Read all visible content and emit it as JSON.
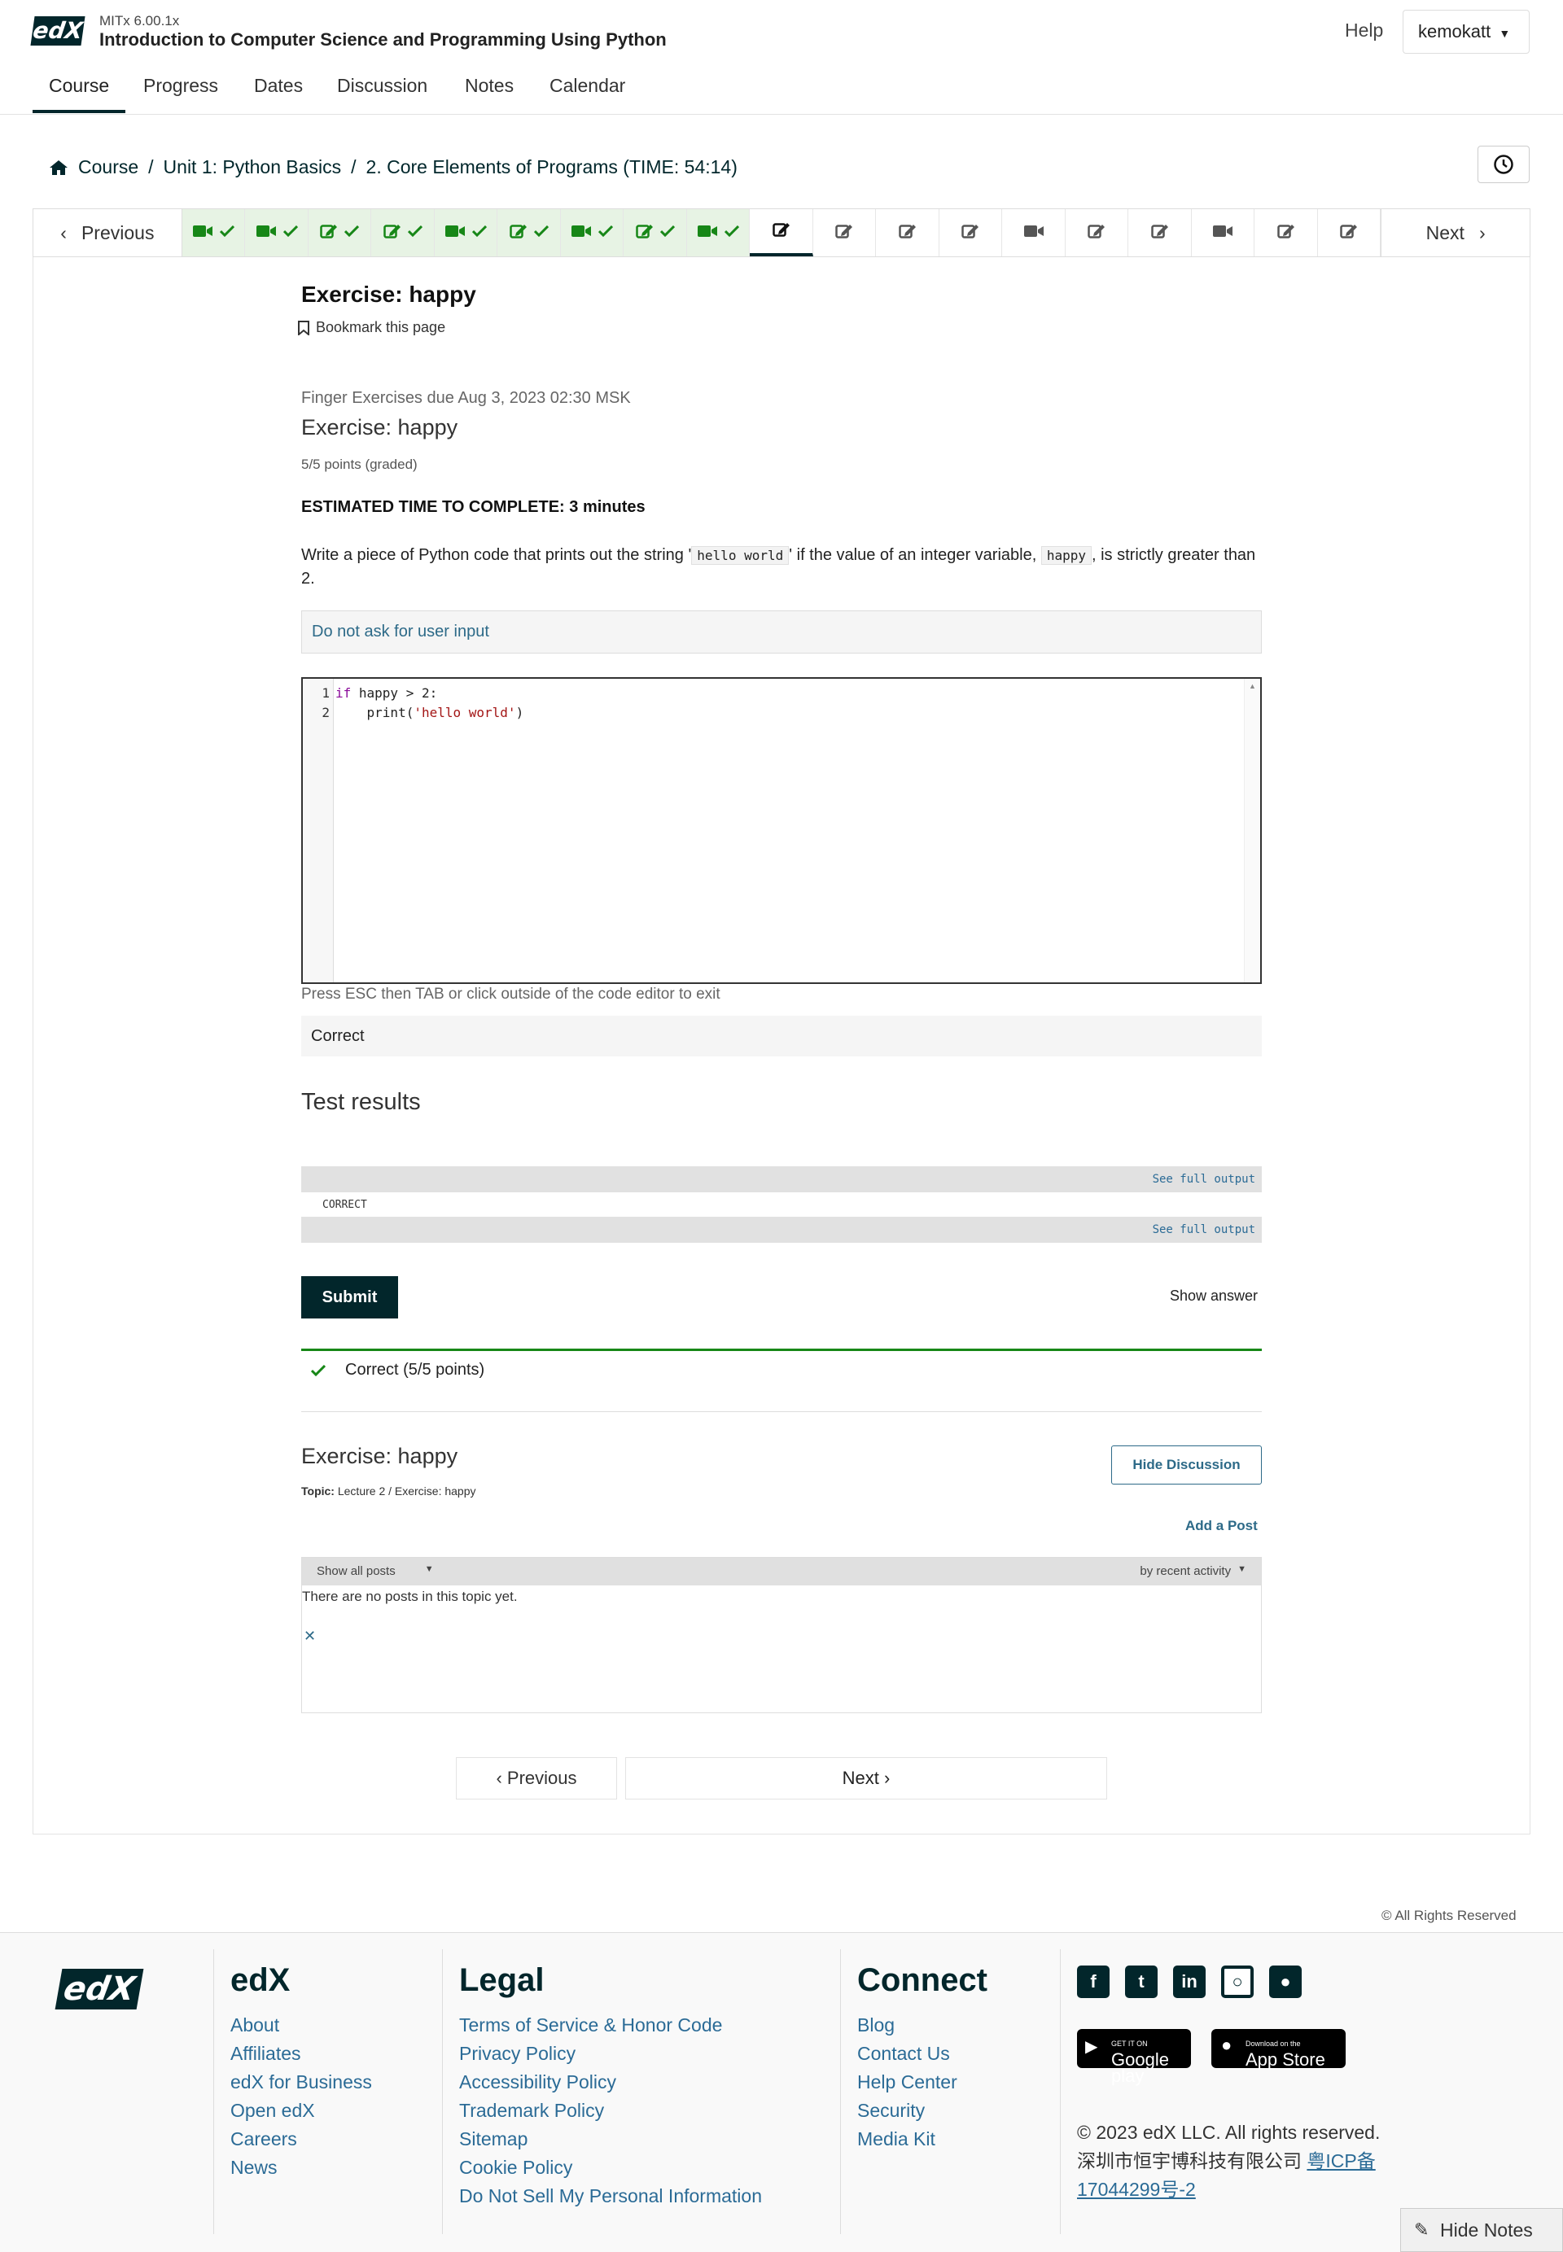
{
  "header": {
    "course_code": "MITx 6.00.1x",
    "course_title": "Introduction to Computer Science and Programming Using Python",
    "help": "Help",
    "username": "kemokatt",
    "tabs": [
      {
        "label": "Course"
      },
      {
        "label": "Progress"
      },
      {
        "label": "Dates"
      },
      {
        "label": "Discussion"
      },
      {
        "label": "Notes"
      },
      {
        "label": "Calendar"
      }
    ]
  },
  "breadcrumb": {
    "course": "Course",
    "unit": "Unit 1: Python Basics",
    "section": "2. Core Elements of Programs (TIME: 54:14)"
  },
  "sequence": {
    "previous": "Previous",
    "next": "Next",
    "tabs": [
      {
        "icon": "video-icon",
        "done": true
      },
      {
        "icon": "video-icon",
        "done": true
      },
      {
        "icon": "edit-icon",
        "done": true
      },
      {
        "icon": "edit-icon",
        "done": true
      },
      {
        "icon": "video-icon",
        "done": true
      },
      {
        "icon": "edit-icon",
        "done": true
      },
      {
        "icon": "video-icon",
        "done": true
      },
      {
        "icon": "edit-icon",
        "done": true
      },
      {
        "icon": "video-icon",
        "done": true
      },
      {
        "icon": "edit-icon",
        "done": false,
        "current": true
      },
      {
        "icon": "edit-icon",
        "done": false
      },
      {
        "icon": "edit-icon",
        "done": false
      },
      {
        "icon": "edit-icon",
        "done": false
      },
      {
        "icon": "video-icon",
        "done": false
      },
      {
        "icon": "edit-icon",
        "done": false
      },
      {
        "icon": "edit-icon",
        "done": false
      },
      {
        "icon": "video-icon",
        "done": false
      },
      {
        "icon": "edit-icon",
        "done": false
      },
      {
        "icon": "edit-icon",
        "done": false
      }
    ]
  },
  "unit": {
    "title": "Exercise: happy",
    "bookmark": "Bookmark this page"
  },
  "problem": {
    "due": "Finger Exercises due Aug 3, 2023 02:30 MSK",
    "title": "Exercise: happy",
    "points": "5/5 points (graded)",
    "est_time": "ESTIMATED TIME TO COMPLETE: 3 minutes",
    "prompt_before": "Write a piece of Python code that prints out the string '",
    "prompt_code1": "hello world",
    "prompt_middle": "' if the value of an integer variable,",
    "prompt_code2": "happy",
    "prompt_after": ", is strictly greater than 2.",
    "note": "Do not ask for user input",
    "line_numbers": [
      "1",
      "2"
    ],
    "code_line1_kw": "if",
    "code_line1_rest": " happy > 2:",
    "code_line2_indent": "    ",
    "code_line2_fn": "print(",
    "code_line2_str": "'hello world'",
    "code_line2_end": ")",
    "esc_hint": "Press ESC then TAB or click outside of the code editor to exit",
    "correct_label": "Correct",
    "test_results_heading": "Test results",
    "see_full_output": "See full output",
    "test_status": "CORRECT",
    "submit": "Submit",
    "show_answer": "Show answer",
    "result": "Correct (5/5 points)"
  },
  "discussion": {
    "title": "Exercise: happy",
    "topic_label": "Topic:",
    "topic_value": "Lecture 2 / Exercise: happy",
    "hide_button": "Hide Discussion",
    "add_post": "Add a Post",
    "filter": "Show all posts",
    "sort": "by recent activity",
    "empty": "There are no posts in this topic yet."
  },
  "bottom_nav": {
    "previous": "Previous",
    "next": "Next"
  },
  "rights": "All Rights Reserved",
  "footer": {
    "logo_text": "edX",
    "edx_heading": "edX",
    "edx_links": [
      "About",
      "Affiliates",
      "edX for Business",
      "Open edX",
      "Careers",
      "News"
    ],
    "legal_heading": "Legal",
    "legal_links": [
      "Terms of Service & Honor Code",
      "Privacy Policy",
      "Accessibility Policy",
      "Trademark Policy",
      "Sitemap",
      "Cookie Policy",
      "Do Not Sell My Personal Information"
    ],
    "connect_heading": "Connect",
    "connect_links": [
      "Blog",
      "Contact Us",
      "Help Center",
      "Security",
      "Media Kit"
    ],
    "social_icons": [
      "facebook-icon",
      "twitter-icon",
      "linkedin-icon",
      "instagram-icon",
      "reddit-icon"
    ],
    "google_play_small": "GET IT ON",
    "google_play": "Google play",
    "app_store_small": "Download on the",
    "app_store": "App Store",
    "copyright": "© 2023 edX LLC. All rights reserved.",
    "icp_text": "深圳市恒宇博科技有限公司",
    "icp_link": "粤ICP备17044299号-2"
  },
  "hide_notes": "Hide Notes",
  "colors": {
    "brand": "#02262b",
    "link": "#2b6b96",
    "success": "#178717"
  }
}
